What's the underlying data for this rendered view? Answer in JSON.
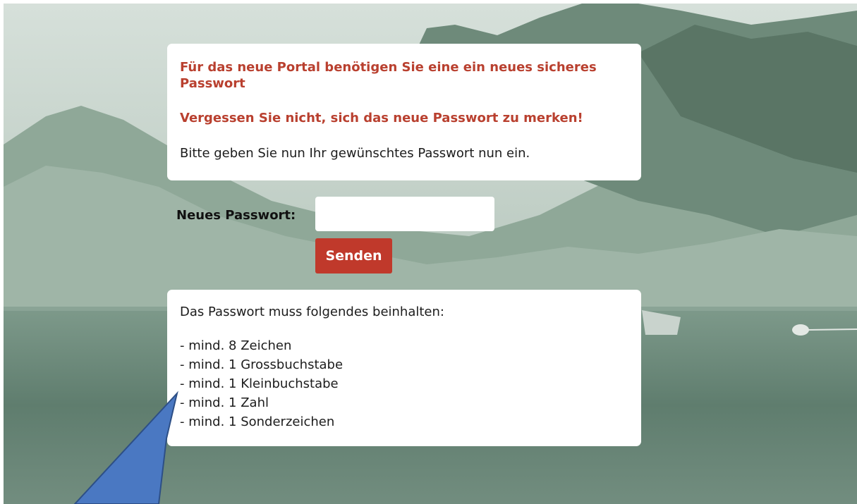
{
  "intro": {
    "headline_1": "Für das neue Portal benötigen Sie eine ein neues sicheres Passwort",
    "headline_2": "Vergessen Sie nicht, sich das neue Passwort zu merken!",
    "instruction": "Bitte geben Sie nun Ihr gewünschtes Passwort nun ein."
  },
  "form": {
    "password_label": "Neues Passwort:",
    "password_value": "",
    "submit_label": "Senden"
  },
  "requirements": {
    "title": "Das Passwort muss folgendes beinhalten:",
    "items": [
      "- mind. 8 Zeichen",
      "- mind. 1 Grossbuchstabe",
      "- mind. 1 Kleinbuchstabe",
      "- mind. 1 Zahl",
      "- mind. 1 Sonderzeichen"
    ]
  },
  "colors": {
    "accent": "#c0392b",
    "headline": "#b9402f",
    "arrow": "#4a78c2"
  }
}
